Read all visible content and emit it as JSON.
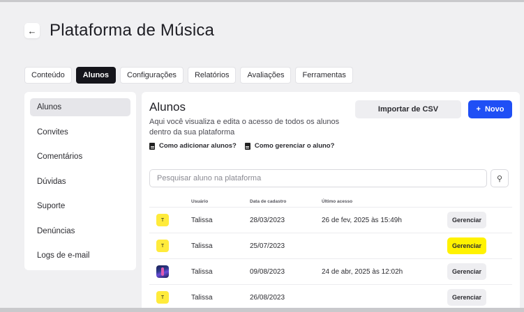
{
  "header": {
    "back_icon": "arrow-left-icon",
    "back_glyph": "←",
    "title": "Plataforma de Música"
  },
  "tabs": [
    {
      "label": "Conteúdo",
      "active": false
    },
    {
      "label": "Alunos",
      "active": true
    },
    {
      "label": "Configurações",
      "active": false
    },
    {
      "label": "Relatórios",
      "active": false
    },
    {
      "label": "Avaliações",
      "active": false
    },
    {
      "label": "Ferramentas",
      "active": false
    }
  ],
  "sidebar": {
    "items": [
      {
        "label": "Alunos",
        "active": true
      },
      {
        "label": "Convites",
        "active": false
      },
      {
        "label": "Comentários",
        "active": false
      },
      {
        "label": "Dúvidas",
        "active": false
      },
      {
        "label": "Suporte",
        "active": false
      },
      {
        "label": "Denúncias",
        "active": false
      },
      {
        "label": "Logs de e-mail",
        "active": false
      }
    ]
  },
  "main": {
    "title": "Alunos",
    "description": "Aqui você visualiza e edita o acesso de todos os alunos dentro da sua plataforma",
    "help_links": [
      {
        "label": "Como adicionar alunos?",
        "icon": "document-icon"
      },
      {
        "label": "Como gerenciar o aluno?",
        "icon": "document-icon"
      }
    ],
    "import_button": "Importar de CSV",
    "new_button": {
      "label": "Novo",
      "glyph": "+"
    },
    "search": {
      "placeholder": "Pesquisar aluno na plataforma",
      "value": "",
      "icon": "search-icon",
      "glyph": "⚲"
    }
  },
  "table": {
    "columns": [
      "",
      "Usuário",
      "Data de cadastro",
      "Último acesso",
      ""
    ],
    "rows": [
      {
        "avatar": "T",
        "avatar_type": "initial",
        "user": "Talissa",
        "registered": "28/03/2023",
        "last_access": "26 de fev, 2025 às 15:49h",
        "action": "Gerenciar",
        "highlighted": false
      },
      {
        "avatar": "T",
        "avatar_type": "initial",
        "user": "Talissa",
        "registered": "25/07/2023",
        "last_access": "",
        "action": "Gerenciar",
        "highlighted": true
      },
      {
        "avatar": "",
        "avatar_type": "photo",
        "user": "Talissa",
        "registered": "09/08/2023",
        "last_access": "24 de abr, 2025 às 12:02h",
        "action": "Gerenciar",
        "highlighted": false
      },
      {
        "avatar": "T",
        "avatar_type": "initial",
        "user": "Talissa",
        "registered": "26/08/2023",
        "last_access": "",
        "action": "Gerenciar",
        "highlighted": false
      }
    ]
  },
  "colors": {
    "accent": "#1f4ff5",
    "active_tab": "#15151b",
    "avatar_yellow": "#ffeb3b",
    "highlight": "#fff200",
    "background": "#f0f0f2"
  }
}
